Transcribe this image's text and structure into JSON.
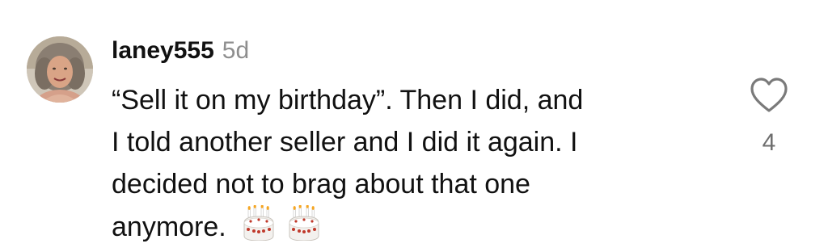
{
  "comment": {
    "username": "laney555",
    "time": "5d",
    "lines": [
      "“Sell it on my birthday”. Then I did, and",
      "I told another seller and I did it again. I",
      "decided not to brag about that one",
      "anymore."
    ],
    "emoji": [
      "cake-emoji",
      "cake-emoji"
    ],
    "like_icon": "heart-outline-icon",
    "like_count": "4"
  }
}
